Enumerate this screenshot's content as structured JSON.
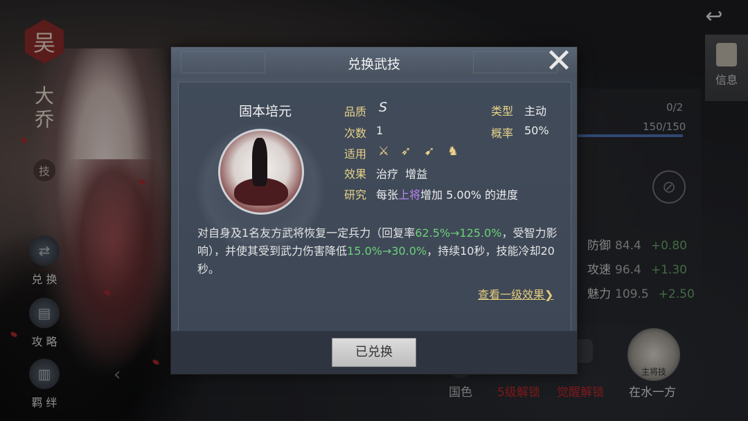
{
  "left_panel": {
    "faction": "吴",
    "hero_name": "大乔",
    "tech_label": "技",
    "buttons": [
      {
        "label": "兑 换"
      },
      {
        "label": "攻 略"
      },
      {
        "label": "羁 绊"
      }
    ]
  },
  "top_right": {
    "info_label": "信息"
  },
  "right_panel": {
    "count_text": "0/2",
    "troops_text": "150/150",
    "stats": [
      {
        "name": "防御",
        "value": "84.4",
        "increment": "+0.80"
      },
      {
        "name": "攻速",
        "value": "96.4",
        "increment": "+1.30"
      },
      {
        "name": "魅力",
        "value": "109.5",
        "increment": "+2.50"
      }
    ]
  },
  "bottom_tabs": {
    "national_color": "国色",
    "unlock_lv5": "5级解锁",
    "awaken_unlock": "觉醒解锁",
    "general_skill_badge": "主将技",
    "general_skill_name": "在水一方"
  },
  "modal": {
    "title": "兑换武技",
    "skill_name": "固本培元",
    "attrs": {
      "quality_label": "品质",
      "quality_value": "S",
      "type_label": "类型",
      "type_value": "主动",
      "count_label": "次数",
      "count_value": "1",
      "chance_label": "概率",
      "chance_value": "50%",
      "apply_label": "适用",
      "effect_label": "效果",
      "effect_value": "治疗  增益",
      "research_label": "研究",
      "research_pre": "每张",
      "research_highlight": "上将",
      "research_post": "增加 5.00% 的进度"
    },
    "applicable_weapons": [
      "sword-icon",
      "bow-icon",
      "spear-icon",
      "horse-icon"
    ],
    "description": {
      "p1": "对自身及1名友方武将恢复一定兵力（回复率",
      "g1": "62.5%→125.0%",
      "p2": "，受智力影响），并使其受到武力伤害降低",
      "g2": "15.0%→30.0%",
      "p3": "，持续10秒，技能冷却20秒。"
    },
    "view_link": "查看一级效果❯",
    "button_label": "已兑换"
  },
  "colors": {
    "label_gold": "#e7d38a",
    "green": "#6ed07a",
    "purple": "#b985f0",
    "red": "#c0282a"
  }
}
